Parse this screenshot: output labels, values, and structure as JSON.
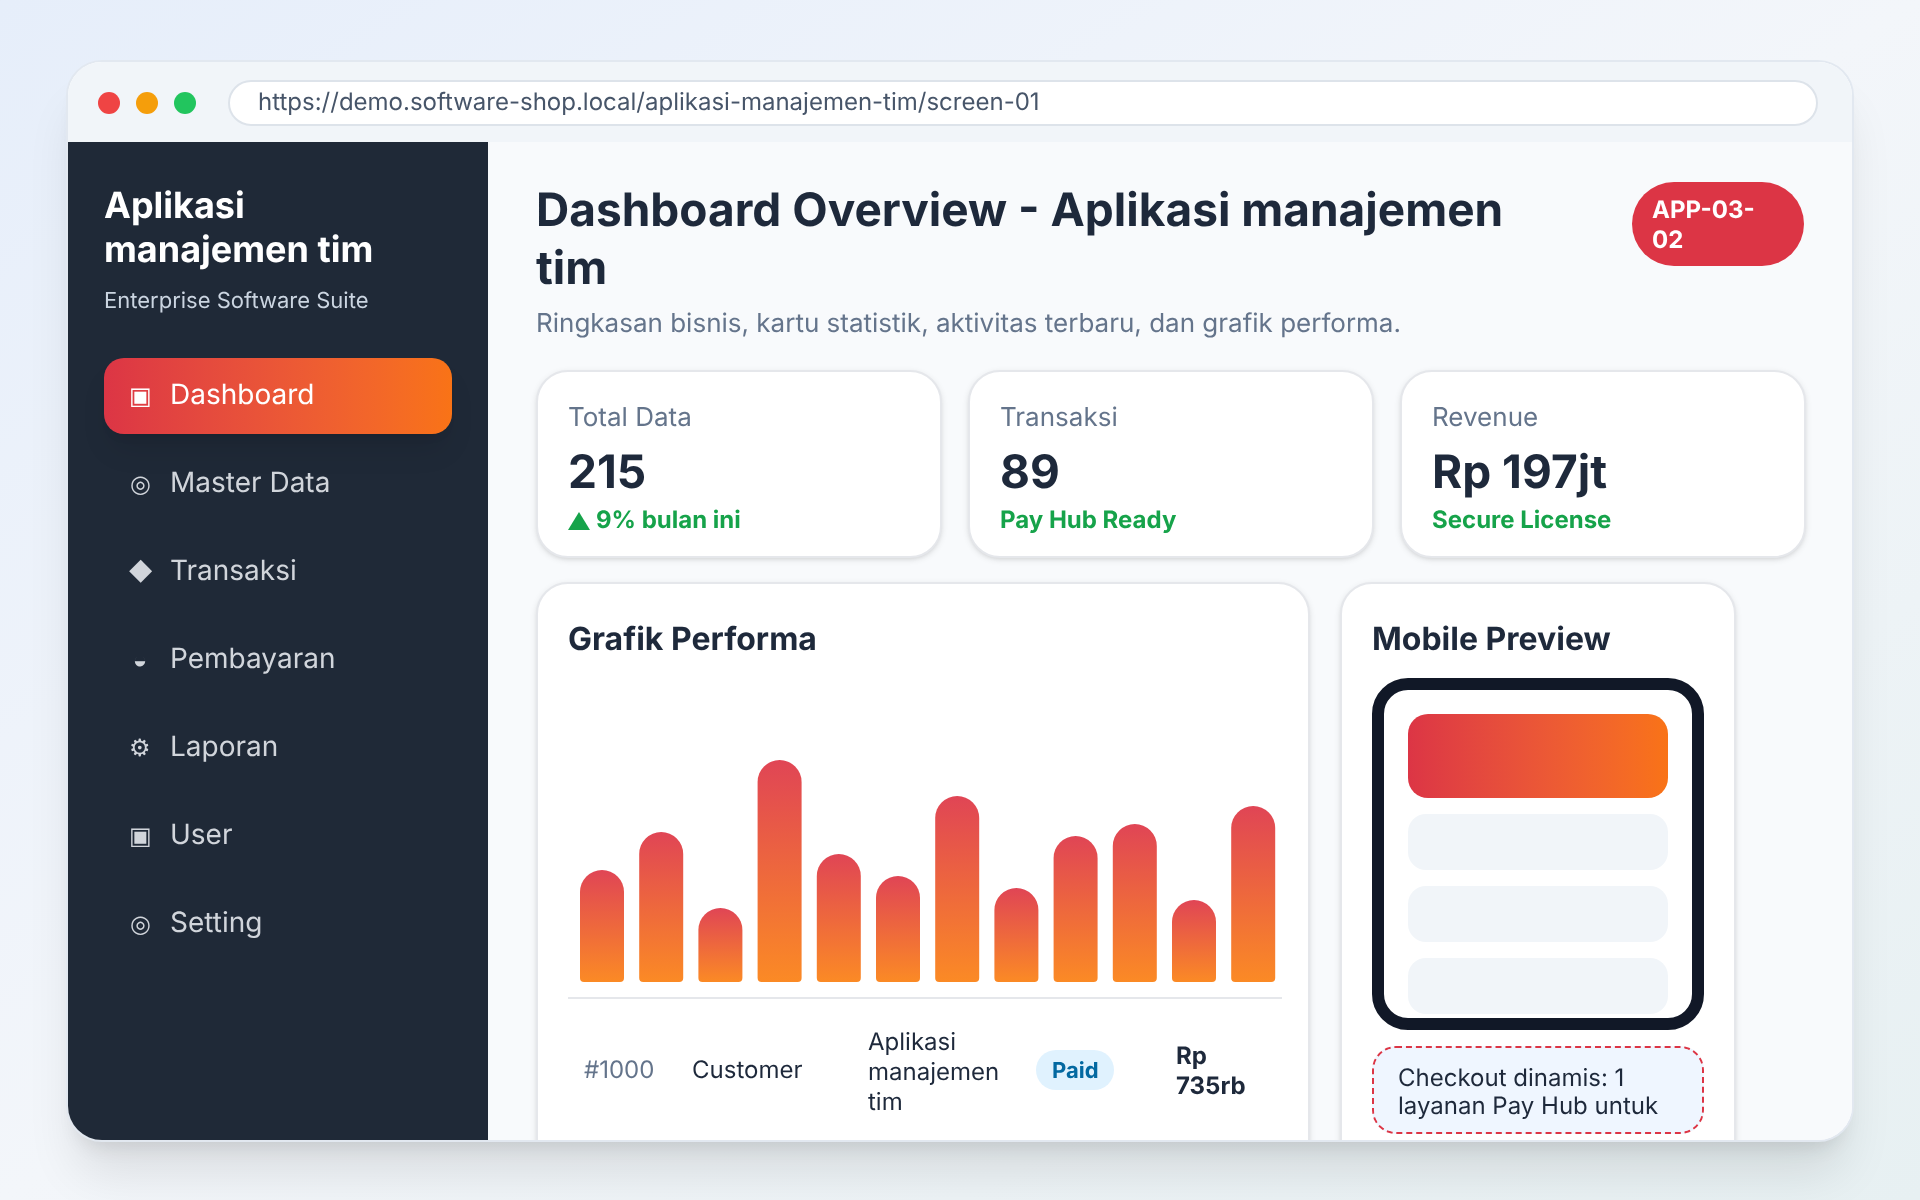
{
  "browser": {
    "url": "https://demo.software-shop.local/aplikasi-manajemen-tim/screen-01"
  },
  "sidebar": {
    "title": "Aplikasi manajemen tim",
    "subtitle": "Enterprise Software Suite",
    "items": [
      {
        "icon": "▣",
        "label": "Dashboard",
        "selected": true
      },
      {
        "icon": "◎",
        "label": "Master Data",
        "selected": false
      },
      {
        "icon": "◆",
        "label": "Transaksi",
        "selected": false
      },
      {
        "icon": "◒",
        "label": "Pembayaran",
        "selected": false
      },
      {
        "icon": "⚙",
        "label": "Laporan",
        "selected": false
      },
      {
        "icon": "▣",
        "label": "User",
        "selected": false
      },
      {
        "icon": "◎",
        "label": "Setting",
        "selected": false
      }
    ]
  },
  "header": {
    "title": "Dashboard Overview - Aplikasi manajemen tim",
    "badge": "APP-03-02",
    "subtitle": "Ringkasan bisnis, kartu statistik, aktivitas terbaru, dan grafik performa."
  },
  "stats": [
    {
      "label": "Total Data",
      "value": "215",
      "note": "9% bulan ini",
      "trend_up": true
    },
    {
      "label": "Transaksi",
      "value": "89",
      "note": "Pay Hub Ready",
      "trend_up": false
    },
    {
      "label": "Revenue",
      "value": "Rp 197jt",
      "note": "Secure License",
      "trend_up": false
    }
  ],
  "chart_card": {
    "title": "Grafik Performa",
    "rows": [
      {
        "column_1": "#1000",
        "column_2": "Customer",
        "column_3": "Aplikasi manajemen tim",
        "status": "Paid",
        "amount": "Rp 735rb"
      }
    ]
  },
  "mobile_preview": {
    "title": "Mobile Preview",
    "note": "Checkout dinamis: 1 layanan Pay Hub untuk"
  }
}
